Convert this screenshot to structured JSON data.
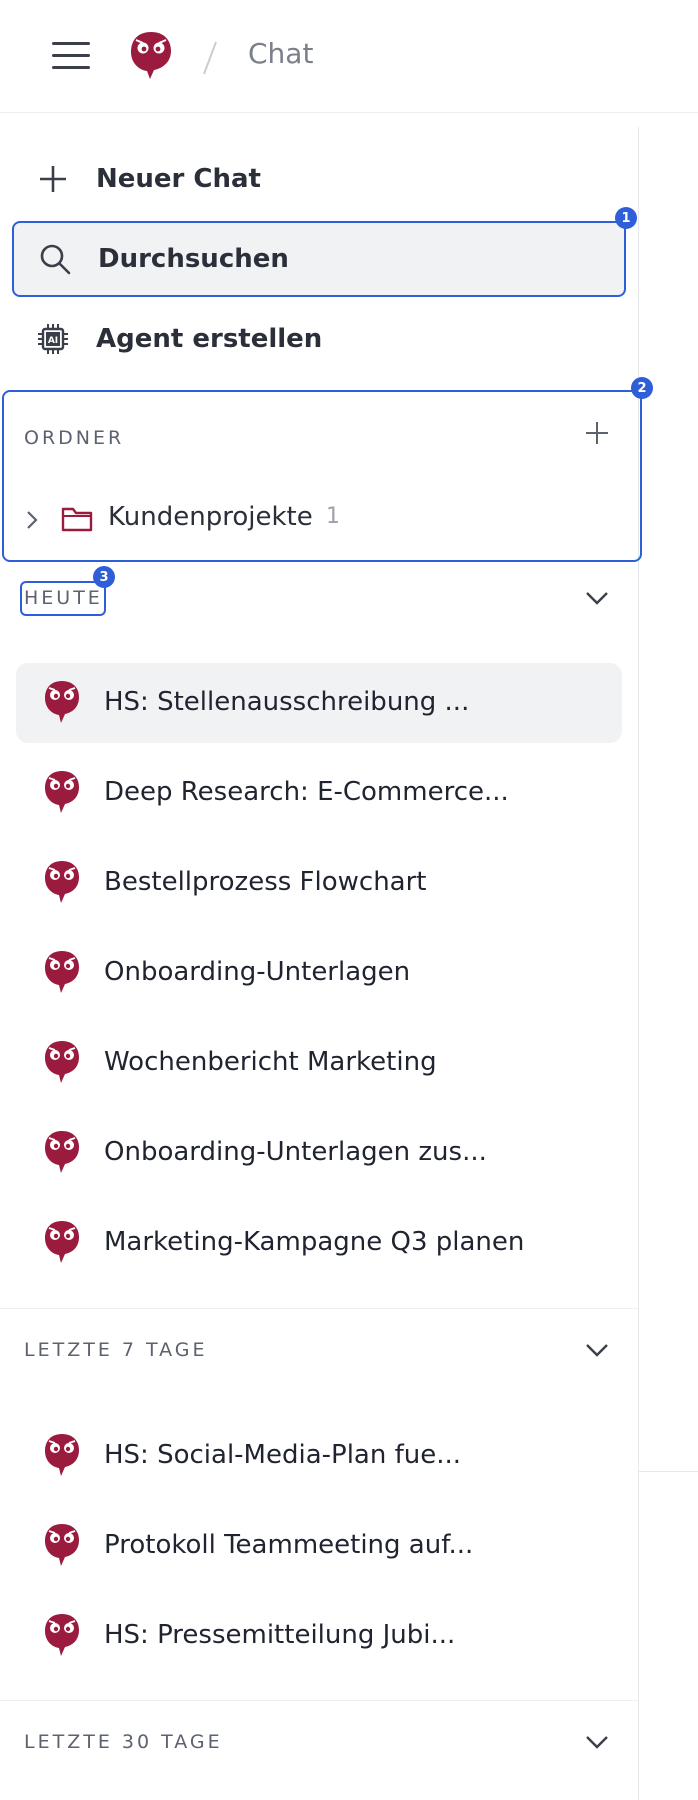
{
  "header": {
    "title": "Chat"
  },
  "actions": {
    "new_chat": "Neuer Chat",
    "search": "Durchsuchen",
    "create_agent": "Agent erstellen"
  },
  "badges": [
    "1",
    "2",
    "3"
  ],
  "folders": {
    "label": "ORDNER",
    "items": [
      {
        "name": "Kundenprojekte",
        "count": "1"
      }
    ]
  },
  "sections": {
    "today": {
      "label": "HEUTE",
      "items": [
        "HS: Stellenausschreibung ...",
        "Deep Research: E-Commerce...",
        "Bestellprozess Flowchart",
        "Onboarding-Unterlagen",
        "Wochenbericht Marketing",
        "Onboarding-Unterlagen zus...",
        "Marketing-Kampagne Q3 planen"
      ]
    },
    "last7": {
      "label": "LETZTE 7 TAGE",
      "items": [
        "HS: Social-Media-Plan fue...",
        "Protokoll Teammeeting auf...",
        "HS: Pressemitteilung Jubi..."
      ]
    },
    "last30": {
      "label": "LETZTE 30 TAGE"
    }
  },
  "colors": {
    "brand": "#9b1b3f",
    "highlight": "#2f5fd8"
  }
}
